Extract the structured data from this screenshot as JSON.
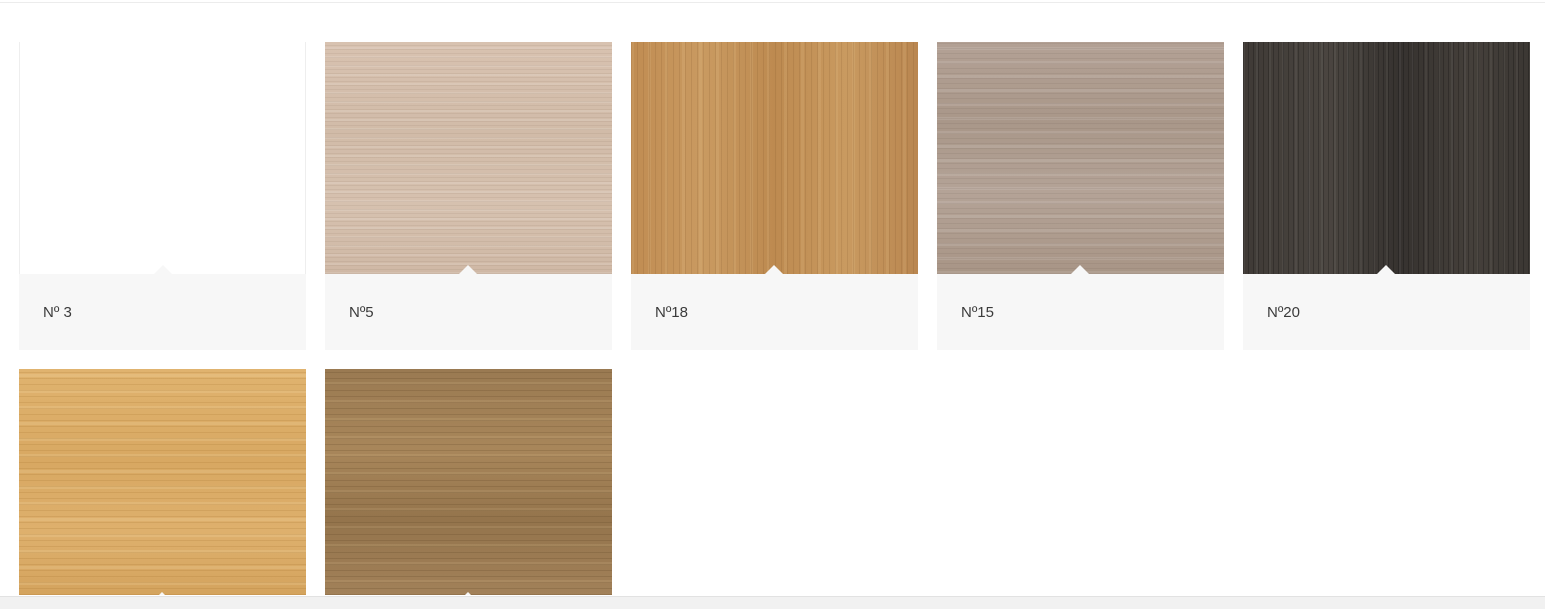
{
  "swatches_row1": [
    {
      "label": "Nº 3",
      "texture": "white-wood-icon"
    },
    {
      "label": "Nº5",
      "texture": "light-ash-wood-icon"
    },
    {
      "label": "Nº18",
      "texture": "natural-oak-wood-icon"
    },
    {
      "label": "Nº15",
      "texture": "grey-oak-wood-icon"
    },
    {
      "label": "Nº20",
      "texture": "dark-oak-wood-icon"
    }
  ],
  "swatches_row2": [
    {
      "texture": "honey-oak-wood-icon"
    },
    {
      "texture": "brown-oak-wood-icon"
    }
  ],
  "colors": {
    "label_bg": "#f7f7f7",
    "label_text": "#3b3b3b"
  }
}
